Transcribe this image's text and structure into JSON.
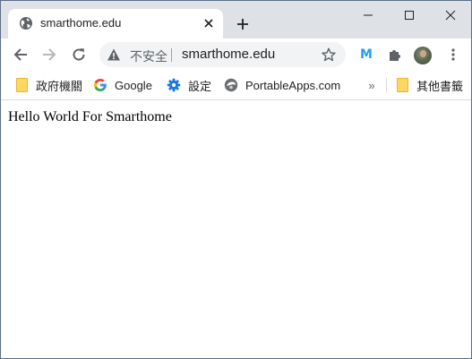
{
  "tab": {
    "title": "smarthome.edu",
    "favicon": "globe-icon"
  },
  "omnibox": {
    "security_label": "不安全",
    "url": "smarthome.edu"
  },
  "bookmarks": [
    {
      "label": "政府機關",
      "icon": "folder-icon"
    },
    {
      "label": "Google",
      "icon": "google-icon"
    },
    {
      "label": "設定",
      "icon": "gear-icon"
    },
    {
      "label": "PortableApps.com",
      "icon": "portableapps-icon"
    }
  ],
  "bookmarks_other": {
    "label": "其他書籤",
    "icon": "folder-icon"
  },
  "page": {
    "text": "Hello World For Smarthome"
  },
  "colors": {
    "titlebar": "#dee1e6",
    "omnibox": "#f1f3f4",
    "folder": "#fdd663",
    "gear": "#1a73e8"
  }
}
